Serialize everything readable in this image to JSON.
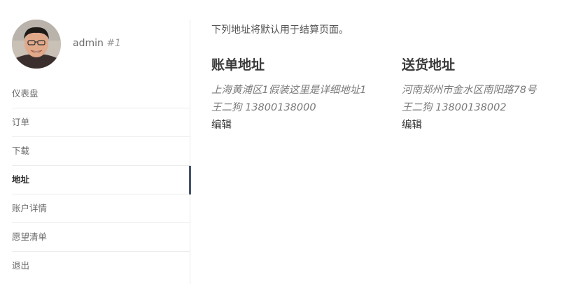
{
  "profile": {
    "username": "admin",
    "user_id": "#1"
  },
  "nav": {
    "items": [
      "仪表盘",
      "订单",
      "下载",
      "地址",
      "账户详情",
      "愿望清单",
      "退出"
    ],
    "active_index": 3
  },
  "main": {
    "intro": "下列地址将默认用于结算页面。",
    "billing": {
      "title": "账单地址",
      "address": "上海黄浦区1假装这里是详细地址1",
      "name_phone": "王二狗 13800138000",
      "edit_label": "编辑"
    },
    "shipping": {
      "title": "送货地址",
      "address": "河南郑州市金水区南阳路78号",
      "name_phone": "王二狗 13800138002",
      "edit_label": "编辑"
    }
  },
  "colors": {
    "active_indicator": "#44546a",
    "border": "#e9e9e9"
  }
}
